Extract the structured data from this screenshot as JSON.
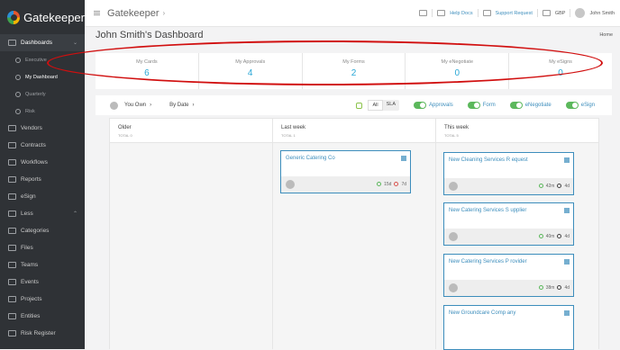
{
  "brand": {
    "name": "Gatekeeper"
  },
  "sidebar": {
    "items": [
      {
        "label": "Dashboards",
        "type": "main",
        "active": true,
        "chevron": "⌄"
      },
      {
        "label": "Executive",
        "type": "sub"
      },
      {
        "label": "My Dashboard",
        "type": "sub",
        "active": true
      },
      {
        "label": "Quarterly",
        "type": "sub"
      },
      {
        "label": "Risk",
        "type": "sub"
      },
      {
        "label": "Vendors",
        "type": "main"
      },
      {
        "label": "Contracts",
        "type": "main"
      },
      {
        "label": "Workflows",
        "type": "main"
      },
      {
        "label": "Reports",
        "type": "main"
      },
      {
        "label": "eSign",
        "type": "main"
      },
      {
        "label": "Less",
        "type": "main"
      },
      {
        "label": "Categories",
        "type": "main"
      },
      {
        "label": "Files",
        "type": "main"
      },
      {
        "label": "Teams",
        "type": "main"
      },
      {
        "label": "Events",
        "type": "main"
      },
      {
        "label": "Projects",
        "type": "main"
      },
      {
        "label": "Entities",
        "type": "main"
      },
      {
        "label": "Risk Register",
        "type": "main"
      }
    ]
  },
  "topbar": {
    "title": "Gatekeeper",
    "help": "Help Docs",
    "support": "Support Request",
    "currency": "GBP",
    "user": "John Smith"
  },
  "page": {
    "title": "John Smith's Dashboard",
    "breadcrumb": "Home"
  },
  "stats": [
    {
      "label": "My Cards",
      "value": "6"
    },
    {
      "label": "My Approvals",
      "value": "4"
    },
    {
      "label": "My Forms",
      "value": "2"
    },
    {
      "label": "My eNegotiate",
      "value": "0"
    },
    {
      "label": "My eSigns",
      "value": "0"
    }
  ],
  "filters": {
    "owner": "You Own",
    "sort": "By Date",
    "seg_all": "All",
    "seg_sla": "SLA",
    "toggles": [
      "Approvals",
      "Form",
      "eNegotiate",
      "eSign"
    ]
  },
  "columns": [
    {
      "name": "Older",
      "total": "TOTAL 0"
    },
    {
      "name": "Last week",
      "total": "TOTAL 1"
    },
    {
      "name": "This week",
      "total": "TOTAL 5"
    }
  ],
  "cards": [
    {
      "title": "Generic Catering Co",
      "time": "15d",
      "sla": "7d"
    },
    {
      "title": "New Cleaning Services R equest",
      "time": "42m",
      "sla": "4d"
    },
    {
      "title": "New Catering Services S upplier",
      "time": "40m",
      "sla": "4d"
    },
    {
      "title": "New Catering Services P rovider",
      "time": "38m",
      "sla": "4d"
    },
    {
      "title": "New Groundcare Comp any",
      "time": "",
      "sla": ""
    }
  ]
}
